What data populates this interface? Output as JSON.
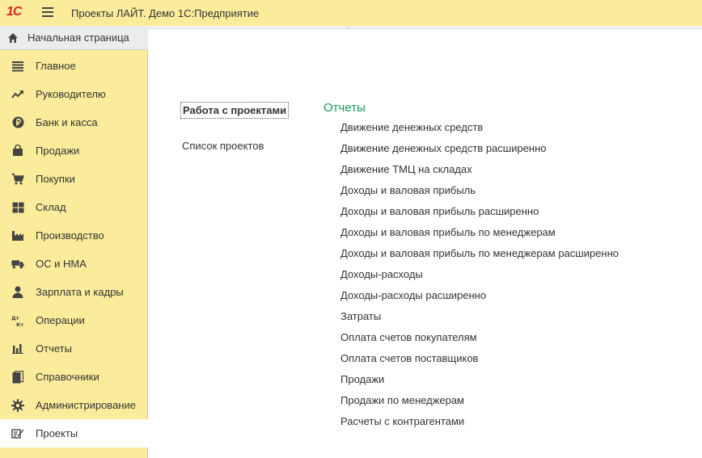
{
  "app": {
    "logo": "1С",
    "title": "Проекты ЛАЙТ. Демо 1С:Предприятие"
  },
  "sidebar": {
    "home": {
      "label": "Начальная страница",
      "icon": "home-icon"
    },
    "items": [
      {
        "label": "Главное",
        "icon": "list-icon"
      },
      {
        "label": "Руководителю",
        "icon": "trend-icon"
      },
      {
        "label": "Банк и касса",
        "icon": "ruble-icon"
      },
      {
        "label": "Продажи",
        "icon": "bag-icon"
      },
      {
        "label": "Покупки",
        "icon": "cart-icon"
      },
      {
        "label": "Склад",
        "icon": "grid-icon"
      },
      {
        "label": "Производство",
        "icon": "factory-icon"
      },
      {
        "label": "ОС и НМА",
        "icon": "truck-icon"
      },
      {
        "label": "Зарплата и кадры",
        "icon": "person-icon"
      },
      {
        "label": "Операции",
        "icon": "dt-kt-icon"
      },
      {
        "label": "Отчеты",
        "icon": "bar-chart-icon"
      },
      {
        "label": "Справочники",
        "icon": "books-icon"
      },
      {
        "label": "Администрирование",
        "icon": "gear-icon"
      },
      {
        "label": "Проекты",
        "icon": "projects-icon",
        "active": true
      }
    ]
  },
  "main": {
    "section_links": {
      "projects_work": "Работа с проектами",
      "projects_list": "Список проектов"
    },
    "reports": {
      "heading": "Отчеты",
      "items": [
        "Движение денежных средств",
        "Движение денежных средств расширенно",
        "Движение ТМЦ на складах",
        "Доходы и валовая прибыль",
        "Доходы и валовая прибыль расширенно",
        "Доходы и валовая прибыль по менеджерам",
        "Доходы и валовая прибыль по менеджерам расширенно",
        "Доходы-расходы",
        "Доходы-расходы расширенно",
        "Затраты",
        "Оплата счетов покупателям",
        "Оплата счетов поставщиков",
        "Продажи",
        "Продажи по менеджерам",
        "Расчеты с контрагентами"
      ]
    }
  },
  "colors": {
    "titlebar": "#fbec9c",
    "logo": "#d8232a",
    "reports_heading": "#12a057"
  }
}
